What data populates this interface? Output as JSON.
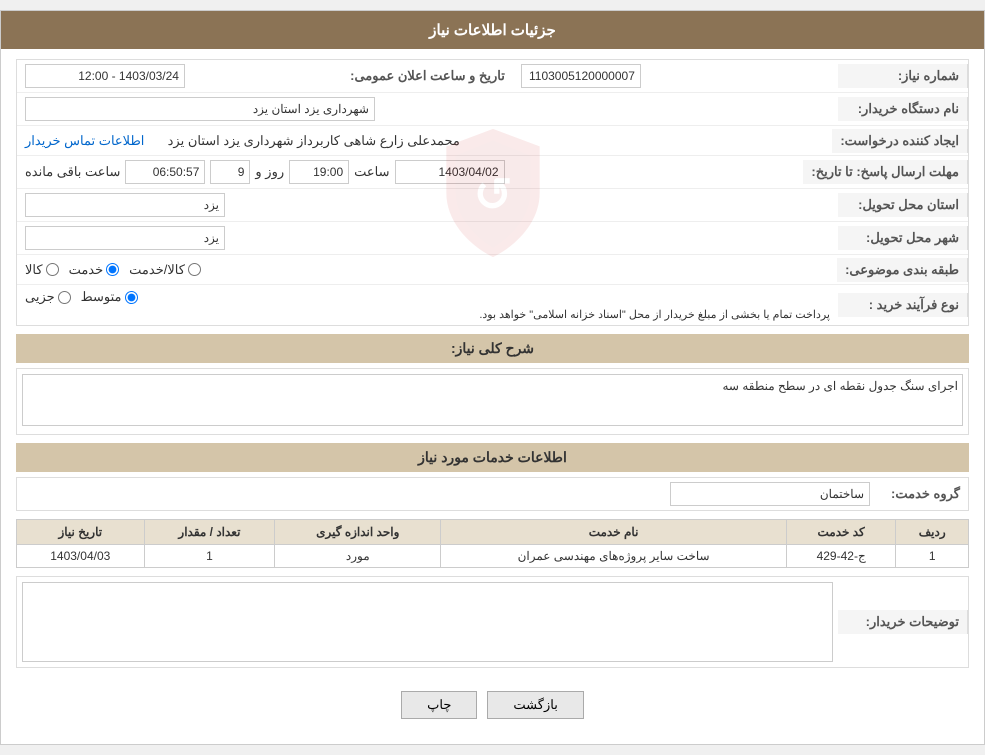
{
  "header": {
    "title": "جزئیات اطلاعات نیاز"
  },
  "labels": {
    "need_number": "شماره نیاز:",
    "buyer_org": "نام دستگاه خریدار:",
    "requester": "ایجاد کننده درخواست:",
    "response_deadline": "مهلت ارسال پاسخ: تا تاریخ:",
    "delivery_province": "استان محل تحویل:",
    "delivery_city": "شهر محل تحویل:",
    "category": "طبقه بندی موضوعی:",
    "purchase_type": "نوع فرآیند خرید :",
    "need_description": "شرح کلی نیاز:",
    "service_info": "اطلاعات خدمات مورد نیاز",
    "service_group": "گروه خدمت:",
    "row": "ردیف",
    "service_code": "کد خدمت",
    "service_name": "نام خدمت",
    "unit": "واحد اندازه گیری",
    "count": "تعداد / مقدار",
    "need_date": "تاریخ نیاز",
    "buyer_notes": "توضیحات خریدار:"
  },
  "values": {
    "need_number": "1103005120000007",
    "buyer_org": "شهرداری یزد استان یزد",
    "requester": "محمدعلی زارع شاهی کاربرداز شهرداری یزد استان یزد",
    "contact_link": "اطلاعات تماس خریدار",
    "announcement_date_label": "تاریخ و ساعت اعلان عمومی:",
    "announcement_date": "1403/03/24 - 12:00",
    "response_date": "1403/04/02",
    "response_time": "19:00",
    "response_days": "9",
    "response_hours": "06:50:57",
    "remaining_label": "ساعت باقی مانده",
    "days_label": "روز و",
    "time_label": "ساعت",
    "delivery_province": "یزد",
    "delivery_city": "یزد",
    "radio_options": [
      "کالا",
      "خدمت",
      "کالا/خدمت"
    ],
    "radio_selected": "خدمت",
    "purchase_options": [
      "جزیی",
      "متوسط"
    ],
    "purchase_selected": "متوسط",
    "purchase_note": "پرداخت تمام یا بخشی از مبلغ خریدار از محل \"اسناد خزانه اسلامی\" خواهد بود.",
    "need_description_text": "اجرای سنگ جدول نقطه ای در سطح منطقه سه",
    "service_group_value": "ساختمان",
    "table": {
      "rows": [
        {
          "row": "1",
          "code": "ج-42-429",
          "name": "ساخت سایر پروژه‌های مهندسی عمران",
          "unit": "مورد",
          "count": "1",
          "date": "1403/04/03"
        }
      ]
    },
    "buyer_notes_text": ""
  },
  "buttons": {
    "print": "چاپ",
    "back": "بازگشت"
  }
}
